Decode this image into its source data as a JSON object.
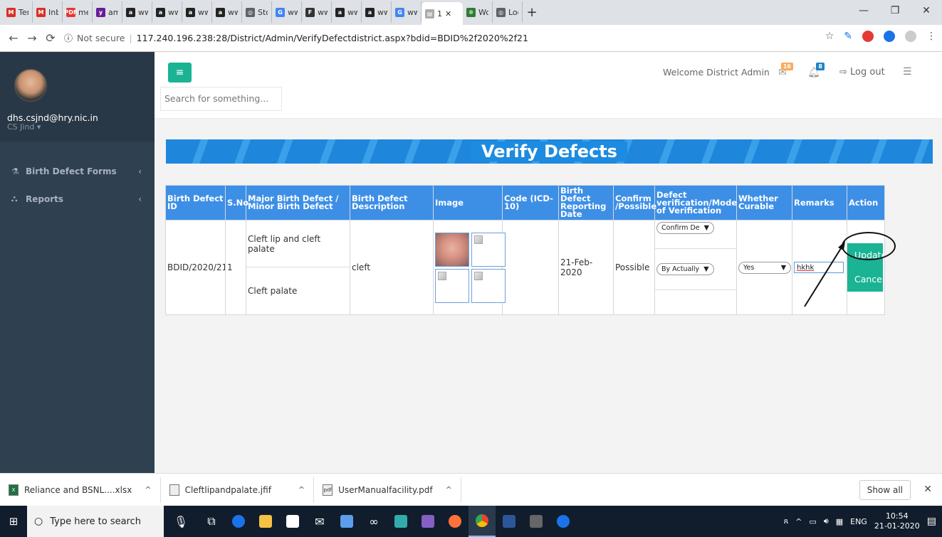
{
  "browser": {
    "tabs": [
      {
        "label": "Temp",
        "fav": "M",
        "color": "#d93025"
      },
      {
        "label": "Inbox",
        "fav": "M",
        "color": "#d93025"
      },
      {
        "label": "mem",
        "fav": "PDF",
        "color": "#e53935"
      },
      {
        "label": "amaz",
        "fav": "y",
        "color": "#6a1b9a"
      },
      {
        "label": "www",
        "fav": "a",
        "color": "#222"
      },
      {
        "label": "www",
        "fav": "a",
        "color": "#222"
      },
      {
        "label": "www",
        "fav": "a",
        "color": "#222"
      },
      {
        "label": "www",
        "fav": "a",
        "color": "#222"
      },
      {
        "label": "Store",
        "fav": "◎",
        "color": "#5f6368"
      },
      {
        "label": "www",
        "fav": "G",
        "color": "#4285f4"
      },
      {
        "label": "www",
        "fav": "F",
        "color": "#333"
      },
      {
        "label": "www",
        "fav": "a",
        "color": "#222"
      },
      {
        "label": "www",
        "fav": "a",
        "color": "#222"
      },
      {
        "label": "www",
        "fav": "G",
        "color": "#4285f4"
      },
      {
        "label": "1",
        "fav": "▤",
        "color": "#aaa",
        "active": true
      },
      {
        "label": "Woo",
        "fav": "✲",
        "color": "#2e7d32"
      },
      {
        "label": "Login",
        "fav": "◎",
        "color": "#5f6368"
      }
    ],
    "security": "Not secure",
    "url": "117.240.196.238:28/District/Admin/VerifyDefectdistrict.aspx?bdid=BDID%2f2020%2f21"
  },
  "sidebar": {
    "email": "dhs.csjnd@hry.nic.in",
    "role": "CS Jind",
    "items": [
      {
        "label": "Birth Defect Forms",
        "icon": "flask-icon"
      },
      {
        "label": "Reports",
        "icon": "sitemap-icon"
      }
    ]
  },
  "topbar": {
    "search_placeholder": "Search for something...",
    "welcome": "Welcome District Admin",
    "messages_count": "16",
    "alerts_count": "8",
    "logout": "Log out"
  },
  "page": {
    "title": "Verify Defects"
  },
  "table": {
    "headers": [
      "Birth Defect ID",
      "S.No",
      "Major Birth Defect / Minor Birth Defect",
      "Birth Defect Description",
      "Image",
      "Code (ICD-10)",
      "Birth Defect Reporting Date",
      "Confirm /Possible",
      "Defect verification/Mode of Verification",
      "Whether Curable",
      "Remarks",
      "Action"
    ],
    "row": {
      "id": "BDID/2020/21",
      "sno": "1",
      "major": "Cleft lip and cleft palate",
      "minor": "Cleft palate",
      "description": "cleft",
      "code": "",
      "date": "21-Feb-2020",
      "confirm": "Possible",
      "verification": "Confirm De",
      "mode": "By Actually",
      "curable": "Yes",
      "remarks": "hkhk",
      "update": "Update",
      "cancel": "Cancel"
    }
  },
  "downloads": [
    {
      "name": "Reliance and BSNL....xlsx"
    },
    {
      "name": "Cleftlipandpalate.jfif"
    },
    {
      "name": "UserManualfacility.pdf"
    }
  ],
  "downloads_showall": "Show all",
  "taskbar": {
    "search": "Type here to search",
    "lang": "ENG",
    "time": "10:54",
    "date": "21-01-2020"
  }
}
